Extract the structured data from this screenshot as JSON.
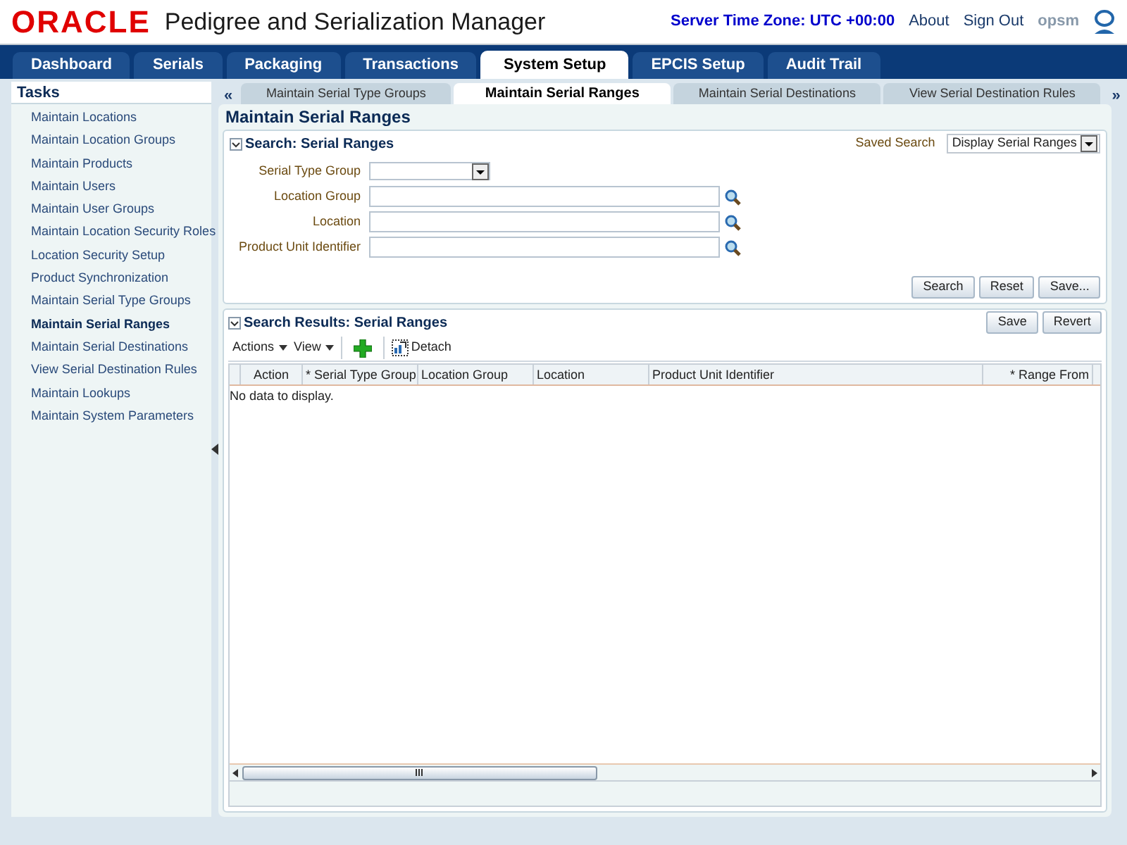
{
  "header": {
    "logo": "ORACLE",
    "app_title": "Pedigree and Serialization Manager",
    "server_time": "Server Time Zone: UTC +00:00",
    "links": [
      "About",
      "Sign Out",
      "opsm"
    ]
  },
  "main_tabs": [
    {
      "label": "Dashboard",
      "selected": false
    },
    {
      "label": "Serials",
      "selected": false
    },
    {
      "label": "Packaging",
      "selected": false
    },
    {
      "label": "Transactions",
      "selected": false
    },
    {
      "label": "System Setup",
      "selected": true
    },
    {
      "label": "EPCIS Setup",
      "selected": false
    },
    {
      "label": "Audit Trail",
      "selected": false
    }
  ],
  "tasks": {
    "title": "Tasks",
    "items": [
      {
        "label": "Maintain Locations",
        "selected": false
      },
      {
        "label": "Maintain Location Groups",
        "selected": false
      },
      {
        "label": "Maintain Products",
        "selected": false
      },
      {
        "label": "Maintain Users",
        "selected": false
      },
      {
        "label": "Maintain User Groups",
        "selected": false
      },
      {
        "label": "Maintain Location Security Roles",
        "selected": false
      },
      {
        "label": "Location Security Setup",
        "selected": false
      },
      {
        "label": "Product Synchronization",
        "selected": false
      },
      {
        "label": "Maintain Serial Type Groups",
        "selected": false
      },
      {
        "label": "Maintain Serial Ranges",
        "selected": true
      },
      {
        "label": "Maintain Serial Destinations",
        "selected": false
      },
      {
        "label": "View Serial Destination Rules",
        "selected": false
      },
      {
        "label": "Maintain Lookups",
        "selected": false
      },
      {
        "label": "Maintain System Parameters",
        "selected": false
      }
    ]
  },
  "sub_tabs": {
    "prev": "«",
    "next": "»",
    "items": [
      {
        "label": "Maintain Serial Type Groups",
        "selected": false
      },
      {
        "label": "Maintain Serial Ranges",
        "selected": true
      },
      {
        "label": "Maintain Serial Destinations",
        "selected": false
      },
      {
        "label": "View Serial Destination Rules",
        "selected": false
      }
    ]
  },
  "page_title": "Maintain Serial Ranges",
  "search": {
    "title": "Search: Serial Ranges",
    "saved_search_label": "Saved Search",
    "saved_search_value": "Display Serial Ranges",
    "fields": [
      {
        "label": "Serial Type Group",
        "kind": "select"
      },
      {
        "label": "Location Group",
        "kind": "lookup"
      },
      {
        "label": "Location",
        "kind": "lookup"
      },
      {
        "label": "Product Unit Identifier",
        "kind": "lookup"
      }
    ],
    "buttons": [
      "Search",
      "Reset",
      "Save..."
    ]
  },
  "results": {
    "title": "Search Results: Serial Ranges",
    "buttons": [
      "Save",
      "Revert"
    ],
    "actions": "Actions",
    "view": "View",
    "detach": "Detach",
    "columns": [
      {
        "label": "Action"
      },
      {
        "label": "* Serial Type Group"
      },
      {
        "label": "Location Group"
      },
      {
        "label": "Location"
      },
      {
        "label": "Product Unit Identifier"
      },
      {
        "label": "* Range From"
      }
    ],
    "empty_text": "No data to display."
  }
}
